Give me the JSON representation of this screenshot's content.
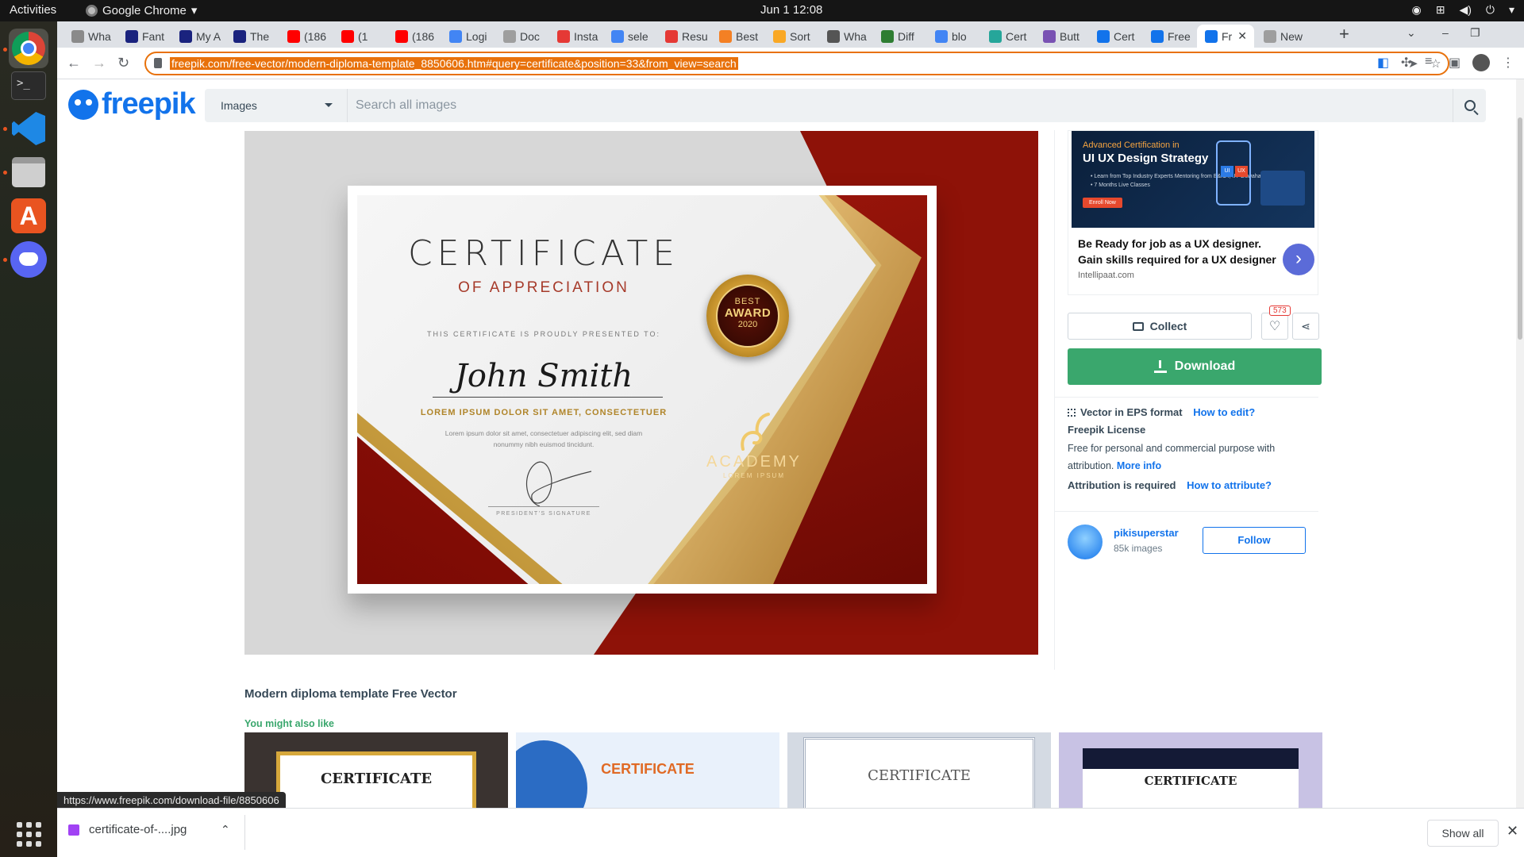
{
  "system": {
    "activities": "Activities",
    "app_name": "Google Chrome",
    "clock": "Jun 1  12:08"
  },
  "dock": {
    "apps": [
      "chrome",
      "terminal",
      "vscode",
      "files",
      "app-center",
      "discord",
      "show-apps"
    ],
    "terminal_glyph": ">_",
    "store_glyph": "A"
  },
  "browser": {
    "tabs": [
      {
        "label": "Wha",
        "icon": "whatsapp",
        "color": "#8a8a8a"
      },
      {
        "label": "Fant",
        "icon": "page",
        "color": "#1a237e"
      },
      {
        "label": "My A",
        "icon": "page",
        "color": "#1a237e"
      },
      {
        "label": "The",
        "icon": "page",
        "color": "#1a237e"
      },
      {
        "label": "(186",
        "icon": "youtube",
        "color": "#ff0000"
      },
      {
        "label": "(1",
        "icon": "youtube",
        "color": "#ff0000"
      },
      {
        "label": "(186",
        "icon": "youtube",
        "color": "#ff0000"
      },
      {
        "label": "Logi",
        "icon": "docs",
        "color": "#4285f4"
      },
      {
        "label": "Doc",
        "icon": "globe",
        "color": "#9e9e9e"
      },
      {
        "label": "Insta",
        "icon": "stack",
        "color": "#e53935"
      },
      {
        "label": "sele",
        "icon": "google",
        "color": "#4285f4"
      },
      {
        "label": "Resu",
        "icon": "stack",
        "color": "#e53935"
      },
      {
        "label": "Best",
        "icon": "stackoverflow",
        "color": "#f48024"
      },
      {
        "label": "Sort",
        "icon": "shield",
        "color": "#f9a825"
      },
      {
        "label": "Wha",
        "icon": "globe",
        "color": "#555555"
      },
      {
        "label": "Diff",
        "icon": "page",
        "color": "#2e7d32"
      },
      {
        "label": "blo",
        "icon": "google",
        "color": "#4285f4"
      },
      {
        "label": "Cert",
        "icon": "page",
        "color": "#26a69a"
      },
      {
        "label": "Butt",
        "icon": "bootstrap",
        "color": "#7952b3"
      },
      {
        "label": "Cert",
        "icon": "freepik",
        "color": "#1273eb"
      },
      {
        "label": "Free",
        "icon": "freepik",
        "color": "#1273eb"
      },
      {
        "label": "Fr",
        "icon": "freepik",
        "color": "#1273eb",
        "active": true
      },
      {
        "label": "New",
        "icon": "newtab",
        "color": "#9e9e9e"
      }
    ],
    "new_tab_glyph": "+",
    "url": "freepik.com/free-vector/modern-diploma-template_8850606.htm#query=certificate&position=33&from_view=search",
    "status_url": "https://www.freepik.com/download-file/8850606"
  },
  "freepik": {
    "logo": "freepik",
    "search_type": "Images",
    "search_placeholder": "Search all images",
    "certificate": {
      "title": "CERTIFICATE",
      "subtitle": "OF APPRECIATION",
      "presented": "THIS CERTIFICATE IS PROUDLY PRESENTED TO:",
      "name": "John Smith",
      "lorem_head": "LOREM IPSUM DOLOR SIT AMET, CONSECTETUER",
      "lorem_body": "Lorem ipsum dolor sit amet, consectetuer adipiscing elit, sed diam nonummy nibh euismod tincidunt.",
      "signature_label": "PRESIDENT'S SIGNATURE",
      "seal_best": "BEST",
      "seal_award": "AWARD",
      "seal_year": "2020",
      "academy": "ACADEMY",
      "academy_sub": "LOREM IPSUM"
    },
    "ad": {
      "banner_kicker": "Advanced Certification in",
      "banner_title": "UI UX Design Strategy",
      "banner_points": "• Learn from Top Industry Experts  Mentoring from E&ICT, IIT Guwahati\n• 7 Months Live Classes",
      "banner_cta": "Enroll Now",
      "banner_ui": "UI",
      "banner_ux": "UX",
      "headline": "Be Ready for job as a UX designer. Gain skills required for a UX designer",
      "domain": "Intellipaat.com",
      "arrow": "›"
    },
    "actions": {
      "collect": "Collect",
      "likes": "573",
      "download": "Download"
    },
    "format_label": "Vector in EPS format",
    "how_to_edit": "How to edit?",
    "license_title": "Freepik License",
    "license_body": "Free for personal and commercial purpose with attribution.",
    "more_info": "More info",
    "attribution_label": "Attribution is required",
    "how_to_attribute": "How to attribute?",
    "author": {
      "name": "pikisuperstar",
      "count": "85k images",
      "follow": "Follow"
    },
    "resource_title": "Modern diploma template Free Vector",
    "also_like": "You might also like",
    "thumbnails": [
      {
        "title": "CERTIFICATE"
      },
      {
        "title": "CERTIFICATE"
      },
      {
        "title": "CERTIFICATE"
      },
      {
        "title": "CERTIFICATE"
      }
    ]
  },
  "downloads": {
    "file": "certificate-of-....jpg",
    "show_all": "Show all"
  }
}
